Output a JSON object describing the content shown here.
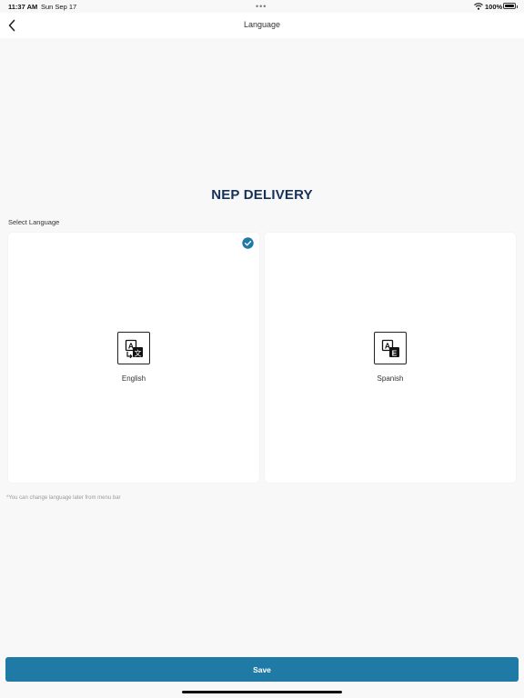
{
  "status_bar": {
    "time": "11:37 AM",
    "date": "Sun Sep 17",
    "multitask_dots": "•••",
    "battery_text": "100%",
    "wifi_icon": "wifi-icon",
    "battery_icon": "battery-icon"
  },
  "nav": {
    "title": "Language",
    "back_icon": "chevron-left-icon"
  },
  "brand": {
    "title": "NEP DELIVERY",
    "color": "#17325a"
  },
  "language_section": {
    "label": "Select Language",
    "options": [
      {
        "label": "English",
        "selected": true,
        "icon": "translate-icon"
      },
      {
        "label": "Spanish",
        "selected": false,
        "icon": "translate-icon"
      }
    ],
    "selected_badge_icon": "check-circle-icon",
    "hint": "*You can change language later from menu bar"
  },
  "footer": {
    "save_label": "Save",
    "accent_color": "#1f7aa5"
  }
}
